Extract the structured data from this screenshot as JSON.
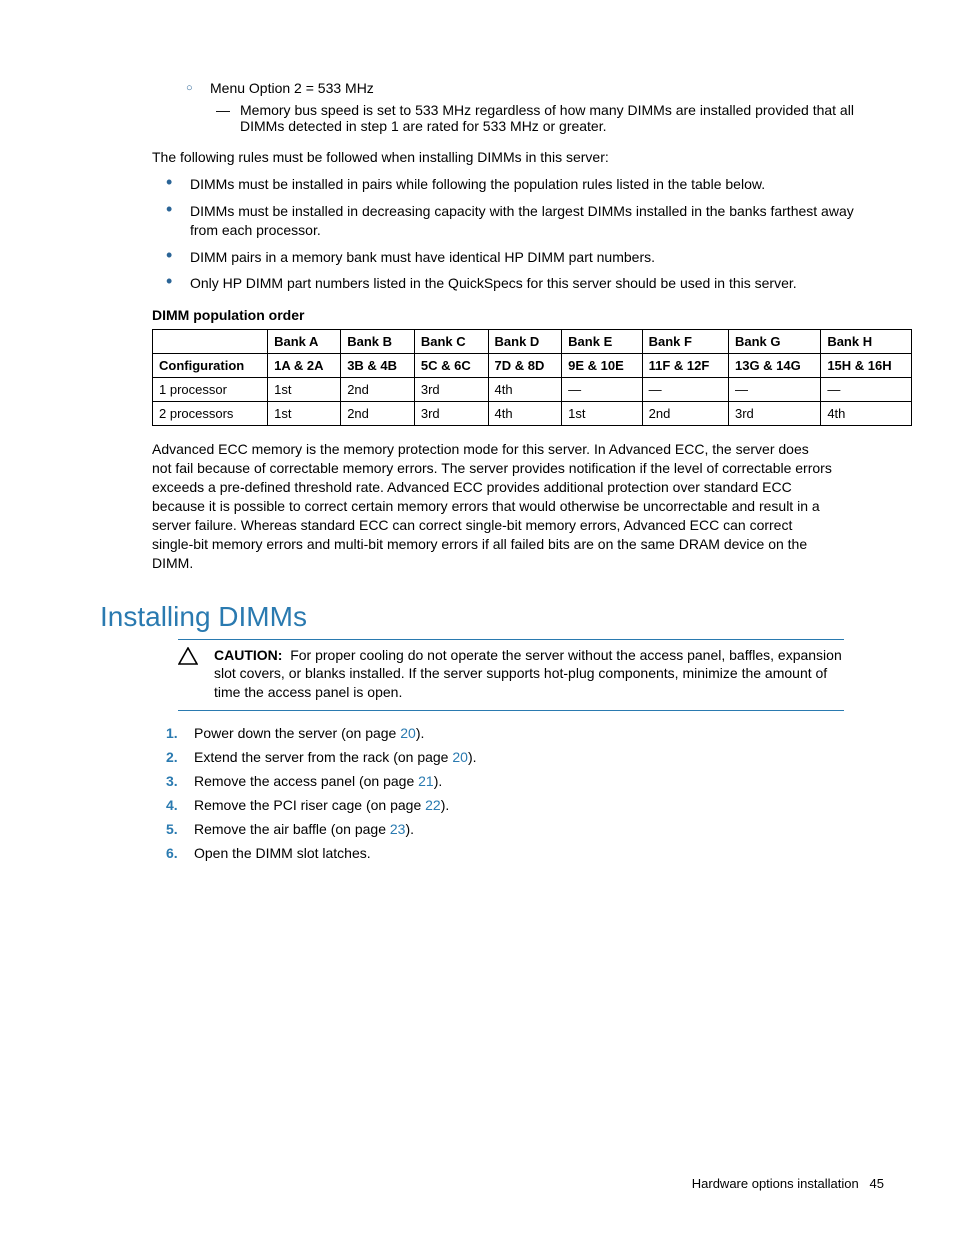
{
  "intro": {
    "menu_option": "Menu Option 2 = 533 MHz",
    "menu_detail": "Memory bus speed is set to 533 MHz regardless of how many DIMMs are installed provided that all DIMMs detected in step 1 are rated for 533 MHz or greater.",
    "rules_intro": "The following rules must be followed when installing DIMMs in this server:",
    "rules": [
      "DIMMs must be installed in pairs while following the population rules listed in the table below.",
      "DIMMs must be installed in decreasing capacity with the largest DIMMs installed in the banks farthest away from each processor.",
      "DIMM pairs in a memory bank must have identical HP DIMM part numbers.",
      "Only HP DIMM part numbers listed in the QuickSpecs for this server should be used in this server."
    ]
  },
  "table": {
    "title": "DIMM population order",
    "header_row1": [
      "",
      "Bank A",
      "Bank B",
      "Bank C",
      "Bank D",
      "Bank E",
      "Bank F",
      "Bank G",
      "Bank H"
    ],
    "header_row2": [
      "Configuration",
      "1A & 2A",
      "3B & 4B",
      "5C & 6C",
      "7D & 8D",
      "9E & 10E",
      "11F & 12F",
      "13G & 14G",
      "15H & 16H"
    ],
    "rows": [
      [
        "1 processor",
        "1st",
        "2nd",
        "3rd",
        "4th",
        "—",
        "—",
        "—",
        "—"
      ],
      [
        "2 processors",
        "1st",
        "2nd",
        "3rd",
        "4th",
        "1st",
        "2nd",
        "3rd",
        "4th"
      ]
    ]
  },
  "ecc_para": "Advanced ECC memory is the memory protection mode for this server. In Advanced ECC, the server does not fail because of correctable memory errors. The server provides notification if the level of correctable errors exceeds a pre-defined threshold rate. Advanced ECC provides additional protection over standard ECC because it is possible to correct certain memory errors that would otherwise be uncorrectable and result in a server failure. Whereas standard ECC can correct single-bit memory errors, Advanced ECC can correct single-bit memory errors and multi-bit memory errors if all failed bits are on the same DRAM device on the DIMM.",
  "section_heading": "Installing DIMMs",
  "caution": {
    "label": "CAUTION:",
    "text": "For proper cooling do not operate the server without the access panel, baffles, expansion slot covers, or blanks installed. If the server supports hot-plug components, minimize the amount of time the access panel is open."
  },
  "steps": [
    {
      "pre": "Power down the server (on page ",
      "link": "20",
      "post": ")."
    },
    {
      "pre": "Extend the server from the rack (on page ",
      "link": "20",
      "post": ")."
    },
    {
      "pre": "Remove the access panel (on page ",
      "link": "21",
      "post": ")."
    },
    {
      "pre": "Remove the PCI riser cage (on page ",
      "link": "22",
      "post": ")."
    },
    {
      "pre": "Remove the air baffle (on page ",
      "link": "23",
      "post": ")."
    },
    {
      "pre": "Open the DIMM slot latches.",
      "link": "",
      "post": ""
    }
  ],
  "footer": {
    "section": "Hardware options installation",
    "page": "45"
  }
}
